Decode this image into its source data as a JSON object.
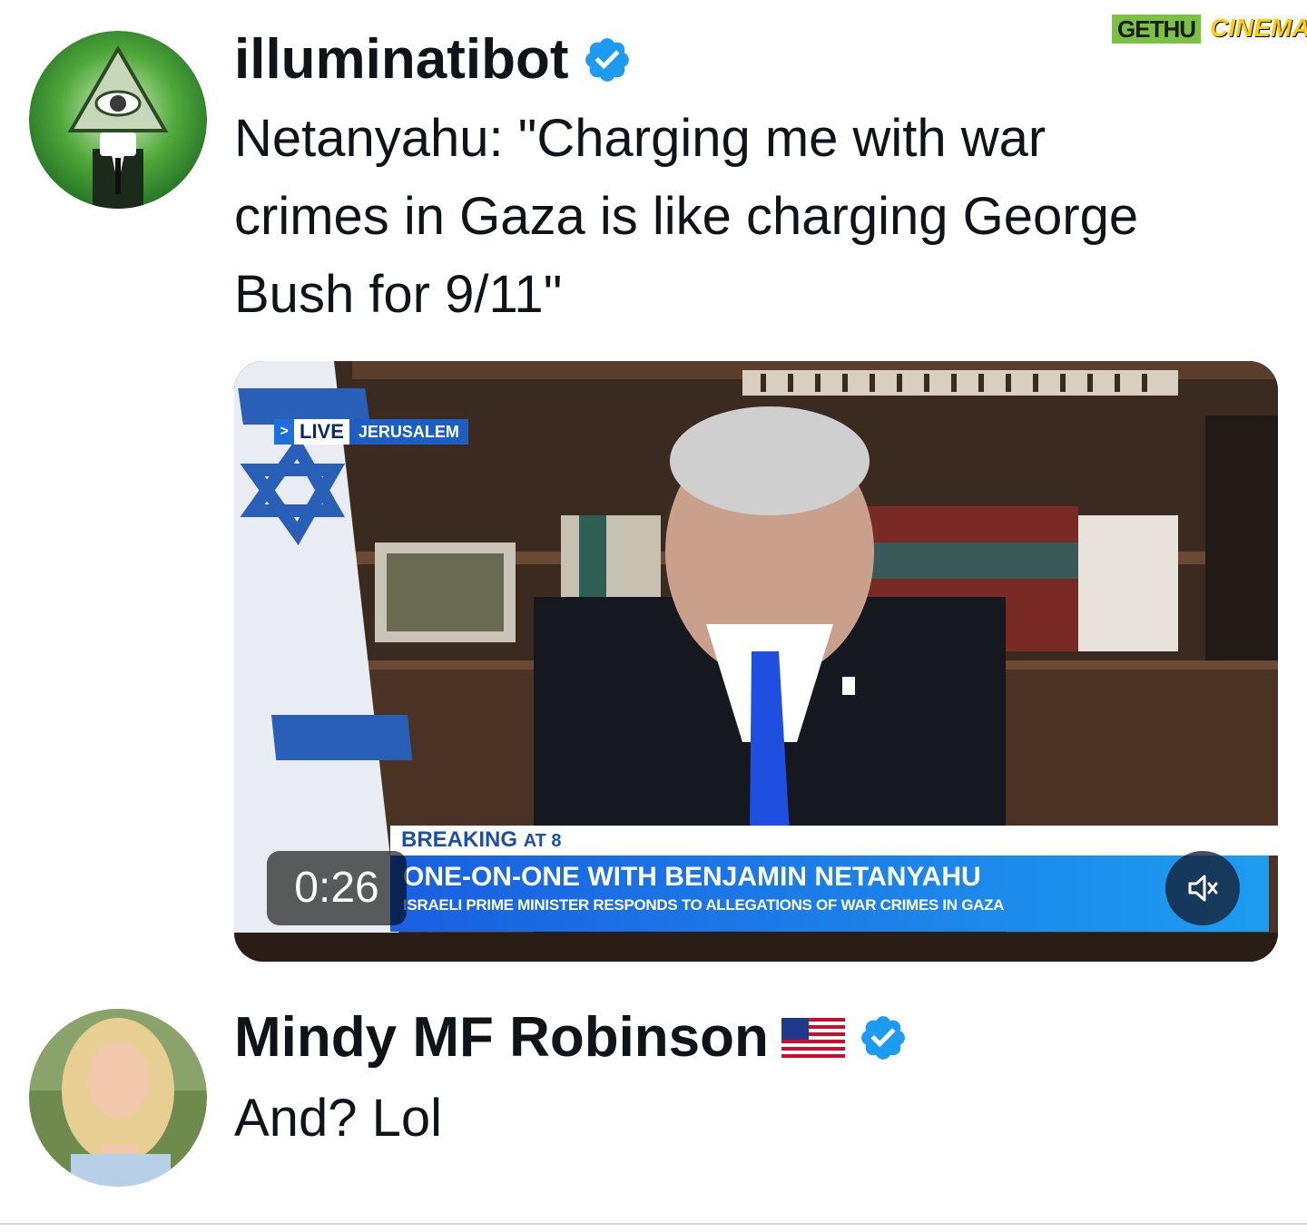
{
  "watermark": {
    "text_left": "GETHU",
    "text_right": "CINEMA"
  },
  "tweets": [
    {
      "display_name": "illuminatibot",
      "verified": true,
      "text_lines": [
        "Netanyahu: \"Charging me with war",
        "crimes in Gaza is like charging George",
        "Bush for 9/11\""
      ],
      "media": {
        "type": "video",
        "duration": "0:26",
        "muted": true,
        "overlay": {
          "live_label": "LIVE",
          "location": "JERUSALEM",
          "breaking": "BREAKING",
          "breaking_suffix": "AT 8",
          "headline": "ONE-ON-ONE WITH BENJAMIN NETANYAHU",
          "subheadline": "ISRAELI PRIME MINISTER RESPONDS TO ALLEGATIONS OF WAR CRIMES IN GAZA"
        }
      }
    },
    {
      "display_name": "Mindy MF Robinson",
      "flag_emoji": "us-flag-icon",
      "verified": true,
      "text_lines": [
        "And? Lol"
      ]
    }
  ],
  "colors": {
    "verified_badge": "#1d9bf0",
    "text_primary": "#0f1419",
    "divider": "#cfd9de"
  }
}
